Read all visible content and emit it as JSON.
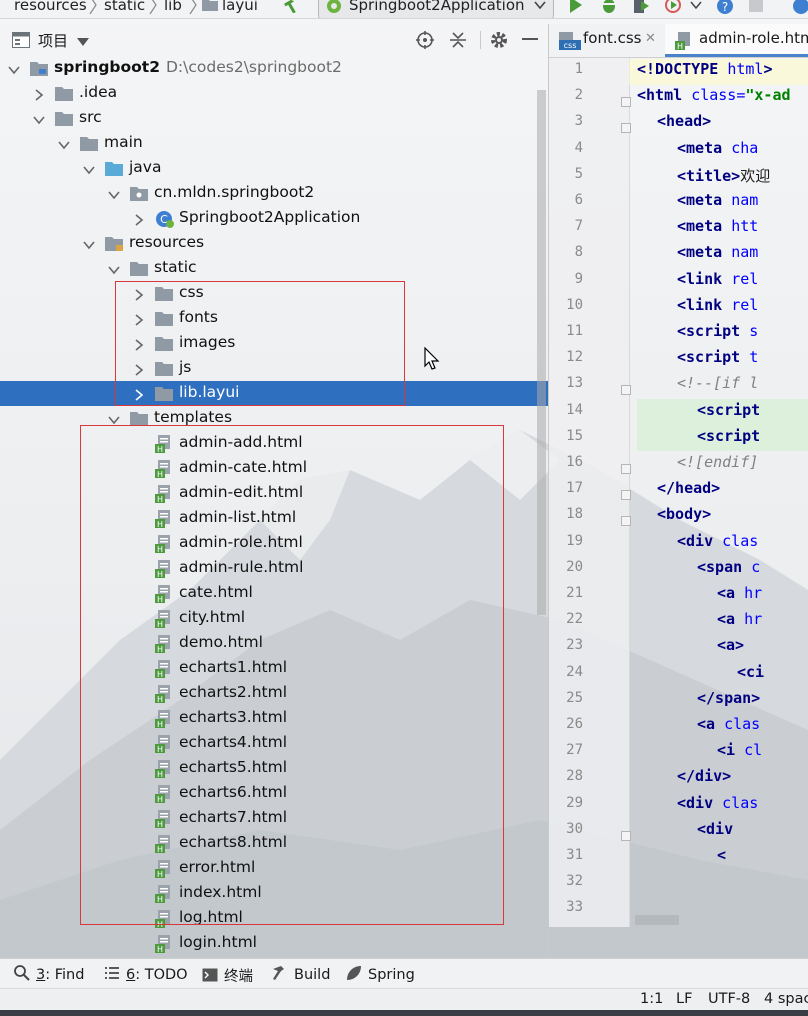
{
  "breadcrumbs": [
    "resources",
    "static",
    "lib",
    "layui"
  ],
  "run_config": {
    "label": "Springboot2Application"
  },
  "project_panel": {
    "title": "项目"
  },
  "tree": [
    {
      "label": "springboot2",
      "path": "D:\\codes2\\springboot2",
      "depth": 0,
      "expanded": true,
      "icon": "module-folder-icon",
      "bold": true
    },
    {
      "label": ".idea",
      "depth": 1,
      "expanded": false,
      "icon": "folder-icon"
    },
    {
      "label": "src",
      "depth": 1,
      "expanded": true,
      "icon": "folder-icon"
    },
    {
      "label": "main",
      "depth": 2,
      "expanded": true,
      "icon": "folder-icon"
    },
    {
      "label": "java",
      "depth": 3,
      "expanded": true,
      "icon": "source-folder-icon"
    },
    {
      "label": "cn.mldn.springboot2",
      "depth": 4,
      "expanded": true,
      "icon": "package-icon"
    },
    {
      "label": "Springboot2Application",
      "depth": 5,
      "expanded": false,
      "icon": "spring-class-icon"
    },
    {
      "label": "resources",
      "depth": 3,
      "expanded": true,
      "icon": "resources-folder-icon"
    },
    {
      "label": "static",
      "depth": 4,
      "expanded": true,
      "icon": "folder-icon"
    },
    {
      "label": "css",
      "depth": 5,
      "expanded": false,
      "icon": "folder-icon"
    },
    {
      "label": "fonts",
      "depth": 5,
      "expanded": false,
      "icon": "folder-icon"
    },
    {
      "label": "images",
      "depth": 5,
      "expanded": false,
      "icon": "folder-icon"
    },
    {
      "label": "js",
      "depth": 5,
      "expanded": false,
      "icon": "folder-icon"
    },
    {
      "label": "lib.layui",
      "depth": 5,
      "expanded": false,
      "icon": "folder-icon",
      "selected": true
    },
    {
      "label": "templates",
      "depth": 4,
      "expanded": true,
      "icon": "folder-icon"
    },
    {
      "label": "admin-add.html",
      "depth": 5,
      "icon": "html-file-icon"
    },
    {
      "label": "admin-cate.html",
      "depth": 5,
      "icon": "html-file-icon"
    },
    {
      "label": "admin-edit.html",
      "depth": 5,
      "icon": "html-file-icon"
    },
    {
      "label": "admin-list.html",
      "depth": 5,
      "icon": "html-file-icon"
    },
    {
      "label": "admin-role.html",
      "depth": 5,
      "icon": "html-file-icon"
    },
    {
      "label": "admin-rule.html",
      "depth": 5,
      "icon": "html-file-icon"
    },
    {
      "label": "cate.html",
      "depth": 5,
      "icon": "html-file-icon"
    },
    {
      "label": "city.html",
      "depth": 5,
      "icon": "html-file-icon"
    },
    {
      "label": "demo.html",
      "depth": 5,
      "icon": "html-file-icon"
    },
    {
      "label": "echarts1.html",
      "depth": 5,
      "icon": "html-file-icon"
    },
    {
      "label": "echarts2.html",
      "depth": 5,
      "icon": "html-file-icon"
    },
    {
      "label": "echarts3.html",
      "depth": 5,
      "icon": "html-file-icon"
    },
    {
      "label": "echarts4.html",
      "depth": 5,
      "icon": "html-file-icon"
    },
    {
      "label": "echarts5.html",
      "depth": 5,
      "icon": "html-file-icon"
    },
    {
      "label": "echarts6.html",
      "depth": 5,
      "icon": "html-file-icon"
    },
    {
      "label": "echarts7.html",
      "depth": 5,
      "icon": "html-file-icon"
    },
    {
      "label": "echarts8.html",
      "depth": 5,
      "icon": "html-file-icon"
    },
    {
      "label": "error.html",
      "depth": 5,
      "icon": "html-file-icon"
    },
    {
      "label": "index.html",
      "depth": 5,
      "icon": "html-file-icon"
    },
    {
      "label": "log.html",
      "depth": 5,
      "icon": "html-file-icon"
    },
    {
      "label": "login.html",
      "depth": 5,
      "icon": "html-file-icon"
    }
  ],
  "editor_tabs": [
    {
      "label": "font.css",
      "icon": "css-file-icon",
      "closable": true
    },
    {
      "label": "admin-role.htm",
      "icon": "html-file-icon",
      "active": true
    }
  ],
  "code_lines": [
    {
      "n": "1",
      "indent": 0,
      "parts": [
        [
          "t",
          "<!DOCTYPE "
        ],
        [
          "a",
          "html"
        ],
        [
          "t",
          ">"
        ]
      ]
    },
    {
      "n": "2",
      "indent": 0,
      "parts": [
        [
          "t",
          "<html "
        ],
        [
          "a",
          "class="
        ],
        [
          "s",
          "\"x-ad"
        ]
      ]
    },
    {
      "n": "3",
      "indent": 1,
      "parts": [
        [
          "t",
          "<head>"
        ]
      ]
    },
    {
      "n": "4",
      "indent": 2,
      "parts": [
        [
          "t",
          "<meta "
        ],
        [
          "a",
          "cha"
        ]
      ]
    },
    {
      "n": "5",
      "indent": 2,
      "parts": [
        [
          "t",
          "<title>"
        ],
        [
          "x",
          "欢迎"
        ]
      ]
    },
    {
      "n": "6",
      "indent": 2,
      "parts": [
        [
          "t",
          "<meta "
        ],
        [
          "a",
          "nam"
        ]
      ]
    },
    {
      "n": "7",
      "indent": 2,
      "parts": [
        [
          "t",
          "<meta "
        ],
        [
          "a",
          "htt"
        ]
      ]
    },
    {
      "n": "8",
      "indent": 2,
      "parts": [
        [
          "t",
          "<meta "
        ],
        [
          "a",
          "nam"
        ]
      ]
    },
    {
      "n": "9",
      "indent": 2,
      "parts": [
        [
          "t",
          "<link "
        ],
        [
          "a",
          "rel"
        ]
      ]
    },
    {
      "n": "10",
      "indent": 2,
      "parts": [
        [
          "t",
          "<link "
        ],
        [
          "a",
          "rel"
        ]
      ]
    },
    {
      "n": "11",
      "indent": 2,
      "parts": [
        [
          "t",
          "<script "
        ],
        [
          "a",
          "s"
        ]
      ]
    },
    {
      "n": "12",
      "indent": 2,
      "parts": [
        [
          "t",
          "<script "
        ],
        [
          "a",
          "t"
        ]
      ]
    },
    {
      "n": "13",
      "indent": 2,
      "parts": [
        [
          "c",
          "<!--[if l"
        ]
      ]
    },
    {
      "n": "14",
      "indent": 3,
      "parts": [
        [
          "t",
          "<script"
        ]
      ]
    },
    {
      "n": "15",
      "indent": 3,
      "parts": [
        [
          "t",
          "<script"
        ]
      ]
    },
    {
      "n": "16",
      "indent": 2,
      "parts": [
        [
          "c",
          "<![endif]"
        ]
      ]
    },
    {
      "n": "17",
      "indent": 1,
      "parts": [
        [
          "t",
          "</head>"
        ]
      ]
    },
    {
      "n": "18",
      "indent": 1,
      "parts": [
        [
          "t",
          "<body>"
        ]
      ]
    },
    {
      "n": "19",
      "indent": 2,
      "parts": [
        [
          "t",
          "<div "
        ],
        [
          "a",
          "clas"
        ]
      ]
    },
    {
      "n": "20",
      "indent": 3,
      "parts": [
        [
          "t",
          "<span "
        ],
        [
          "a",
          "c"
        ]
      ]
    },
    {
      "n": "21",
      "indent": 4,
      "parts": [
        [
          "t",
          "<a "
        ],
        [
          "a",
          "hr"
        ]
      ]
    },
    {
      "n": "22",
      "indent": 4,
      "parts": [
        [
          "t",
          "<a "
        ],
        [
          "a",
          "hr"
        ]
      ]
    },
    {
      "n": "23",
      "indent": 4,
      "parts": [
        [
          "t",
          "<a>"
        ]
      ]
    },
    {
      "n": "24",
      "indent": 5,
      "parts": [
        [
          "t",
          "<ci"
        ]
      ]
    },
    {
      "n": "25",
      "indent": 3,
      "parts": [
        [
          "t",
          "</span>"
        ]
      ]
    },
    {
      "n": "26",
      "indent": 3,
      "parts": [
        [
          "t",
          "<a "
        ],
        [
          "a",
          "clas"
        ]
      ]
    },
    {
      "n": "27",
      "indent": 4,
      "parts": [
        [
          "t",
          "<i "
        ],
        [
          "a",
          "cl"
        ]
      ]
    },
    {
      "n": "28",
      "indent": 2,
      "parts": [
        [
          "t",
          "</div>"
        ]
      ]
    },
    {
      "n": "29",
      "indent": 2,
      "parts": [
        [
          "t",
          "<div "
        ],
        [
          "a",
          "clas"
        ]
      ]
    },
    {
      "n": "30",
      "indent": 3,
      "parts": [
        [
          "t",
          "<div"
        ]
      ]
    },
    {
      "n": "31",
      "indent": 4,
      "parts": [
        [
          "t",
          "<"
        ]
      ]
    },
    {
      "n": "32",
      "indent": 0,
      "parts": []
    },
    {
      "n": "33",
      "indent": 0,
      "parts": []
    }
  ],
  "bottom_tools": [
    {
      "key": "3",
      "label": ": Find",
      "icon": "search-icon"
    },
    {
      "key": "6",
      "label": ": TODO",
      "icon": "todo-list-icon"
    },
    {
      "key": "",
      "label": "终端",
      "icon": "terminal-icon"
    },
    {
      "key": "",
      "label": "Build",
      "icon": "hammer-icon"
    },
    {
      "key": "",
      "label": "Spring",
      "icon": "spring-leaf-icon"
    }
  ],
  "status": {
    "position": "1:1",
    "line_sep": "LF",
    "encoding": "UTF-8",
    "indent": "4 spac"
  },
  "colors": {
    "selection": "#2f6fbf",
    "annotation_red": "#d8373b",
    "folder": "#8f9aa5",
    "source_folder": "#5aaad8",
    "html_badge": "#4d9a3f"
  }
}
